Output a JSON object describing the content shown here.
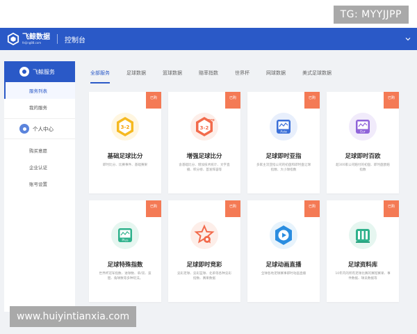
{
  "overlay": {
    "tg_label": "TG: MYYJJPP",
    "url_label": "www.huiyintianxia.com"
  },
  "header": {
    "logo_main": "飞鲸数据",
    "logo_sub": "feijing88.com",
    "title": "控制台",
    "color": "#2a59c7"
  },
  "sidebar": {
    "head_label": "飞鲸服务",
    "items_top": [
      "服务列表",
      "我的服务"
    ],
    "section_label": "个人中心",
    "items_bottom": [
      "购买意愿",
      "企业认证",
      "账号设置"
    ]
  },
  "tabs": [
    "全部服务",
    "足球数据",
    "篮球数据",
    "赔率指数",
    "世界杯",
    "网球数据",
    "美式足球数据"
  ],
  "cards": [
    {
      "badge": "已购",
      "title": "基础足球比分",
      "desc": "即时比分、比赛事件、基础赛果",
      "icon": "football-score-3-2-icon",
      "icon_text": "3-2",
      "color": "#f5b921"
    },
    {
      "badge": "已购",
      "title": "增强足球比分",
      "desc": "含基础比分、增加技术统计、文字直播、积分榜、首发阵容等",
      "icon": "football-score-pro-icon",
      "icon_text": "3-2",
      "color": "#f26b4c"
    },
    {
      "badge": "已购",
      "title": "足球即时亚指",
      "desc": "多家主流亚指公司的初盘和即时盘让球指数、大小球指数",
      "icon": "asia-odds-icon",
      "icon_text": "Asia",
      "color": "#3a6fd8"
    },
    {
      "badge": "已购",
      "title": "足球即时百欧",
      "desc": "超300家公司赔付的初盘、即时盘欧赔指数",
      "icon": "euro-odds-icon",
      "icon_text": "Eur",
      "color": "#8f63d9"
    },
    {
      "badge": "已购",
      "title": "足球特殊指数",
      "desc": "世界杯冠军指数、进球数、单/双、波胆、角球数等多种玩法。",
      "icon": "plus-index-icon",
      "icon_text": "Plus",
      "color": "#2fb28c"
    },
    {
      "badge": "已购",
      "title": "足球即时竞彩",
      "desc": "竞彩足球、竞彩篮球、北单等各种竞彩指数、赛果数据",
      "icon": "lottery-star-icon",
      "icon_text": "",
      "color": "#f26b4c"
    },
    {
      "badge": "已购",
      "title": "足球动画直播",
      "desc": "全球各地足球赛事即时动画直播",
      "icon": "play-animation-icon",
      "icon_text": "",
      "color": "#2a8de0"
    },
    {
      "badge": "已购",
      "title": "足球资料库",
      "desc": "10年内的所有足球比赛的赛程赛果、事件数据、球员数据等",
      "icon": "database-icon",
      "icon_text": "",
      "color": "#2fb28c"
    }
  ]
}
